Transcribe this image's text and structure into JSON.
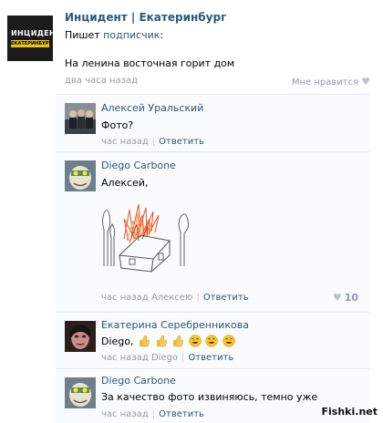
{
  "post": {
    "group_name": "Инцидент | Екатеринбург",
    "writes_prefix": "Пишет ",
    "writes_link": "подписчик",
    "writes_suffix": ":",
    "text": "На ленина восточная горит дом",
    "time": "два часа назад",
    "like_label": "Мне нравится"
  },
  "group_logo": {
    "line1": "ИНЦИДЕНТ",
    "line2": "ЕКАТЕРИНБУРГ"
  },
  "comments": [
    {
      "author": "Алексей Уральский",
      "text": "Фото?",
      "time": "час назад",
      "reply_label": "Ответить"
    },
    {
      "author": "Diego Carbone",
      "text": "Алексей,",
      "time": "час назад",
      "reply_to": "Алексею",
      "reply_label": "Ответить",
      "likes": "10"
    },
    {
      "author": "Екатерина Серебренникова",
      "text": "Diego,",
      "time": "час назад",
      "reply_to": "Diego",
      "reply_label": "Ответить"
    },
    {
      "author": "Diego Carbone",
      "text": "За качество фото извиняюсь, темно уже",
      "time": "час назад",
      "reply_label": "Ответить"
    }
  ],
  "watermark": "Fishki.net",
  "colors": {
    "link": "#2B587A",
    "muted": "#999999",
    "heart": "#B7C4D3"
  }
}
